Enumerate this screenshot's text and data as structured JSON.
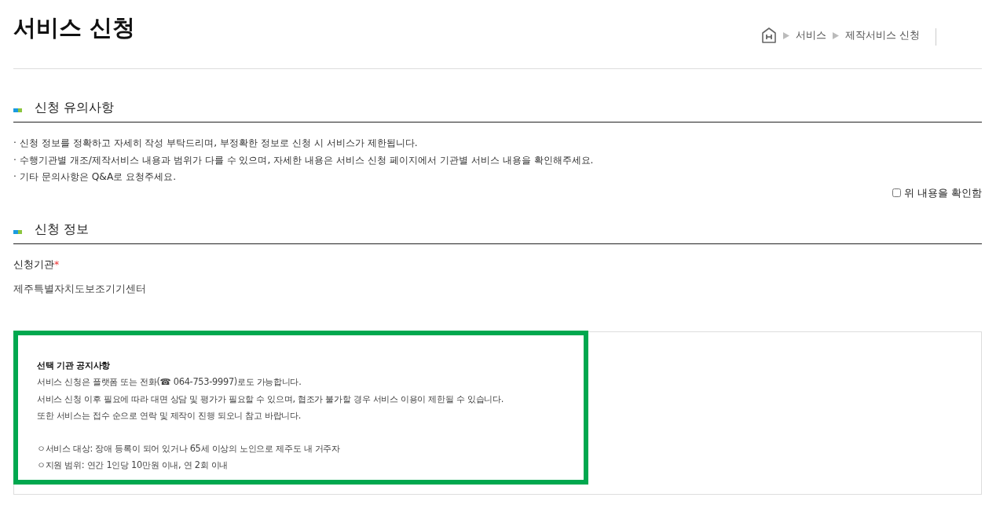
{
  "title": "서비스 신청",
  "breadcrumb": [
    {
      "label": "서비스"
    },
    {
      "label": "제작서비스 신청"
    }
  ],
  "notice_section": {
    "heading": "신청 유의사항",
    "items": [
      "· 신청 정보를 정확하고 자세히 작성 부탁드리며, 부정확한 정보로 신청 시 서비스가 제한됩니다.",
      "· 수행기관별 개조/제작서비스 내용과 범위가 다를 수 있으며, 자세한 내용은 서비스 신청 페이지에서 기관별 서비스 내용을 확인해주세요.",
      "· 기타 문의사항은 Q&A로 요청주세요."
    ],
    "confirm": {
      "label": "위 내용을 확인함",
      "checked": false
    }
  },
  "info_section": {
    "heading": "신청 정보",
    "field_label": "신청기관",
    "required_mark": "*",
    "field_value": "제주특별자치도보조기기센터"
  },
  "agency_notice": {
    "title": "선택 기관 공지사항",
    "lines": [
      {
        "text": "서비스 신청은 플랫폼 또는 전화(☎ 064-753-9997)로도 가능합니다."
      },
      {
        "text": "서비스 신청 이후 필요에 따라 대면 상담 및 평가가 필요할 수 있으며, 협조가 불가할 경우 서비스 이용이 제한될 수 있습니다."
      },
      {
        "text": "또한 서비스는 접수 순으로 연락 및 제작이 진행 되오니 참고 바랍니다."
      },
      {
        "text": "ㅇ서비스 대상: 장애 등록이 되어 있거나 65세 이상의 노인으로 제주도 내 거주자",
        "gap_before": true
      },
      {
        "text": "ㅇ지원 범위: 연간 1인당 10만원 이내, 연 2회 이내"
      }
    ],
    "highlighted": true
  }
}
